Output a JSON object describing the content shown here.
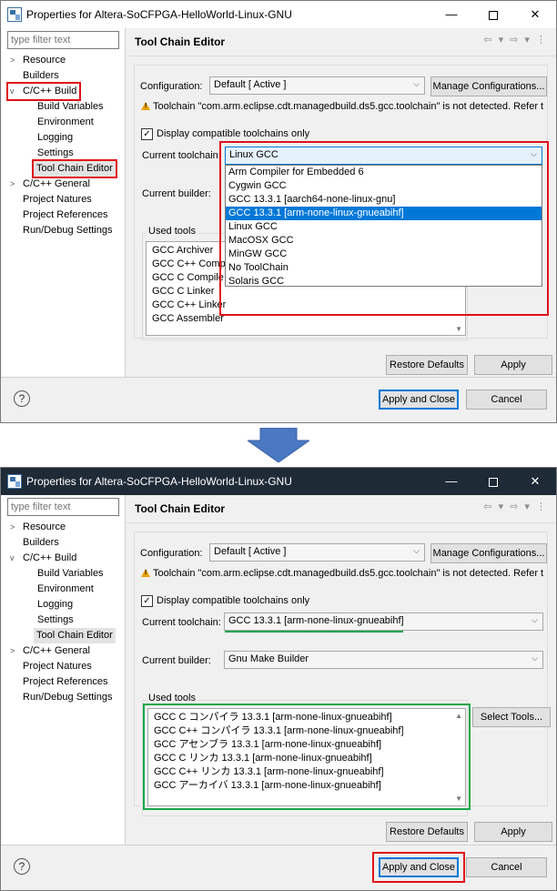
{
  "top": {
    "window_title": "Properties for Altera-SoCFPGA-HelloWorld-Linux-GNU",
    "filter_placeholder": "type filter text",
    "tree": [
      "Resource",
      "Builders",
      "C/C++ Build",
      "Build Variables",
      "Environment",
      "Logging",
      "Settings",
      "Tool Chain Editor",
      "C/C++ General",
      "Project Natures",
      "Project References",
      "Run/Debug Settings"
    ],
    "page_title": "Tool Chain Editor",
    "config_label": "Configuration:",
    "config_value": "Default  [ Active ]",
    "manage_btn": "Manage Configurations...",
    "warning": "Toolchain \"com.arm.eclipse.cdt.managedbuild.ds5.gcc.toolchain\" is not detected. Refer t",
    "compat_label": "Display compatible toolchains only",
    "toolchain_label": "Current toolchain:",
    "toolchain_value": "Linux GCC",
    "builder_label": "Current builder:",
    "used_tools_label": "Used tools",
    "used_tools": [
      "GCC Archiver",
      "GCC C++ Comp",
      "GCC C Compile",
      "GCC C Linker",
      "GCC C++ Linker",
      "GCC Assembler"
    ],
    "dropdown_options": [
      "Arm Compiler for Embedded 6",
      "Cygwin GCC",
      "GCC 13.3.1 [aarch64-none-linux-gnu]",
      "GCC 13.3.1 [arm-none-linux-gnueabihf]",
      "Linux GCC",
      "MacOSX GCC",
      "MinGW GCC",
      "No ToolChain",
      "Solaris GCC"
    ],
    "restore_btn": "Restore Defaults",
    "apply_btn": "Apply",
    "apply_close_btn": "Apply and Close",
    "cancel_btn": "Cancel"
  },
  "bottom": {
    "window_title": "Properties for Altera-SoCFPGA-HelloWorld-Linux-GNU",
    "filter_placeholder": "type filter text",
    "tree": [
      "Resource",
      "Builders",
      "C/C++ Build",
      "Build Variables",
      "Environment",
      "Logging",
      "Settings",
      "Tool Chain Editor",
      "C/C++ General",
      "Project Natures",
      "Project References",
      "Run/Debug Settings"
    ],
    "page_title": "Tool Chain Editor",
    "config_label": "Configuration:",
    "config_value": "Default  [ Active ]",
    "manage_btn": "Manage Configurations...",
    "warning": "Toolchain \"com.arm.eclipse.cdt.managedbuild.ds5.gcc.toolchain\" is not detected. Refer t",
    "compat_label": "Display compatible toolchains only",
    "toolchain_label": "Current toolchain:",
    "toolchain_value": "GCC 13.3.1 [arm-none-linux-gnueabihf]",
    "builder_label": "Current builder:",
    "builder_value": "Gnu Make Builder",
    "used_tools_label": "Used tools",
    "used_tools": [
      "GCC C コンパイラ 13.3.1 [arm-none-linux-gnueabihf]",
      "GCC C++ コンパイラ 13.3.1 [arm-none-linux-gnueabihf]",
      "GCC アセンブラ 13.3.1 [arm-none-linux-gnueabihf]",
      "GCC C リンカ 13.3.1 [arm-none-linux-gnueabihf]",
      "GCC C++ リンカ 13.3.1 [arm-none-linux-gnueabihf]",
      "GCC アーカイバ 13.3.1 [arm-none-linux-gnueabihf]"
    ],
    "select_tools_btn": "Select Tools...",
    "restore_btn": "Restore Defaults",
    "apply_btn": "Apply",
    "apply_close_btn": "Apply and Close",
    "cancel_btn": "Cancel"
  },
  "colors": {
    "highlight_red": "#e0101a",
    "highlight_green": "#1aa64a",
    "selection": "#0078d7",
    "arrow": "#4a78c2"
  }
}
